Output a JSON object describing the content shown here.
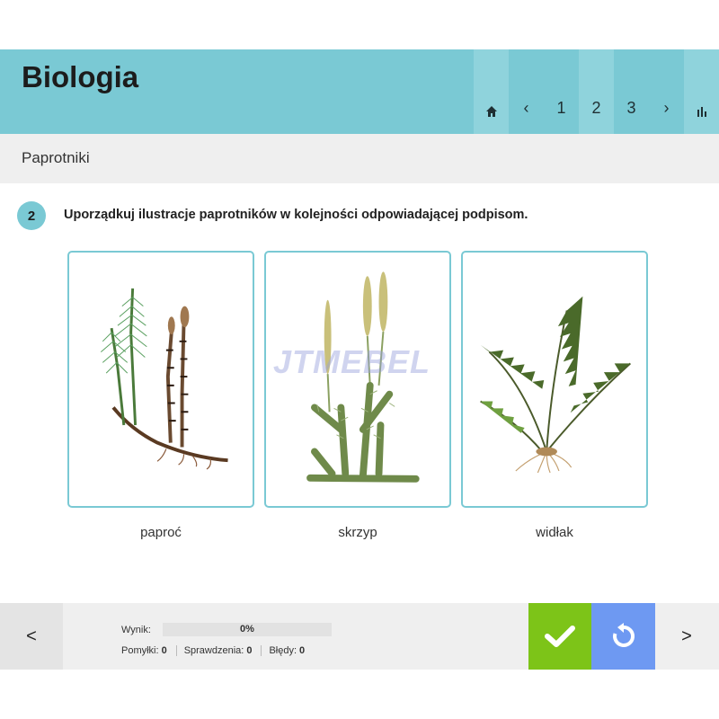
{
  "header": {
    "title": "Biologia",
    "nav": {
      "home_icon": "home-icon",
      "prev": "‹",
      "pages": [
        "1",
        "2",
        "3"
      ],
      "current_page": "2",
      "next": "›",
      "stats_icon": "bar-chart-icon"
    }
  },
  "section": {
    "title": "Paprotniki"
  },
  "question": {
    "number": "2",
    "text": "Uporządkuj ilustracje paprotników w kolejności odpowiadającej podpisom.",
    "cards": [
      {
        "image": "horsetail-illustration"
      },
      {
        "image": "clubmoss-illustration"
      },
      {
        "image": "fern-illustration"
      }
    ],
    "captions": [
      "paproć",
      "skrzyp",
      "widłak"
    ]
  },
  "watermark": "JTMEBEL",
  "footer": {
    "prev": "<",
    "next": ">",
    "score_label": "Wynik:",
    "score_value": "0%",
    "score_fraction": 0,
    "mistakes_label": "Pomyłki:",
    "mistakes": "0",
    "checks_label": "Sprawdzenia:",
    "checks": "0",
    "errors_label": "Błędy:",
    "errors": "0",
    "check_icon": "checkmark-icon",
    "reset_icon": "reset-icon"
  },
  "colors": {
    "accent": "#7ac9d4",
    "accent_light": "#8fd3dc",
    "check": "#7dc418",
    "reset": "#6e99f2",
    "gray": "#efefef"
  }
}
